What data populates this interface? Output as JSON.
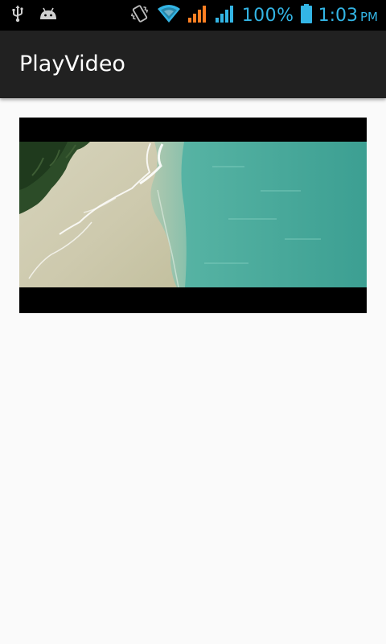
{
  "status_bar": {
    "icons_left": [
      "usb-icon",
      "android-icon"
    ],
    "icons_right": [
      "vibrate-icon",
      "wifi-icon",
      "signal-orange-icon",
      "signal-blue-icon",
      "battery-icon"
    ],
    "battery_percent": "100%",
    "time": "1:03",
    "ampm": "PM",
    "accent_color": "#33b5e5",
    "signal_alt_color": "#ff7f22"
  },
  "app_bar": {
    "title": "PlayVideo",
    "background": "#212121"
  },
  "content": {
    "background": "#fafafa",
    "video": {
      "scene": "aerial-beach-shoreline",
      "letterbox_color": "#000000"
    }
  }
}
